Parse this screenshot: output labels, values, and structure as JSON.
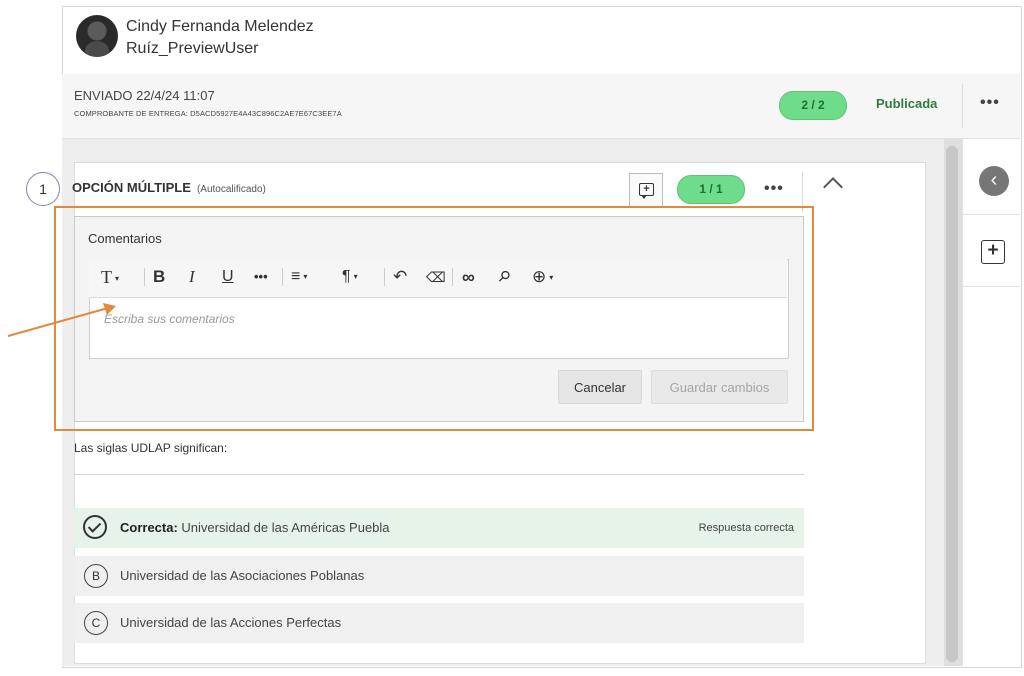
{
  "user": {
    "first_line": "Cindy Fernanda Melendez",
    "second_line": "Ruíz_PreviewUser"
  },
  "submission": {
    "sent_label": "ENVIADO 22/4/24 11:07",
    "receipt": "COMPROBANTE DE ENTREGA: D5ACD5927E4A43C896C2AE7E67C3EE7A",
    "score": "2 / 2",
    "status": "Publicada",
    "more": "•••"
  },
  "question": {
    "number": "1",
    "type": "OPCIÓN MÚLTIPLE",
    "grading": "(Autocalificado)",
    "score": "1 / 1",
    "more": "•••",
    "prompt": "Las siglas UDLAP significan:",
    "options": [
      {
        "mark": "",
        "prefix": "Correcta:",
        "text": " Universidad de las Américas Puebla",
        "note": "Respuesta correcta",
        "correct": true
      },
      {
        "mark": "B",
        "text": "Universidad de las Asociaciones Poblanas"
      },
      {
        "mark": "C",
        "text": "Universidad de las Acciones Perfectas"
      }
    ]
  },
  "comments": {
    "label": "Comentarios",
    "placeholder": "Escriba sus comentarios",
    "cancel": "Cancelar",
    "save": "Guardar cambios",
    "toolbar": {
      "text_style": "T",
      "bold": "B",
      "italic": "I",
      "underline": "U",
      "more": "•••",
      "align": "≡",
      "paragraph": "¶",
      "undo": "↶",
      "eraser": "⌫",
      "link": "∞",
      "attach": "⚲",
      "insert": "⊕"
    }
  },
  "colors": {
    "accent_orange": "#e08a3c",
    "score_green": "#6fdc8c",
    "published_text": "#2e7d3c"
  }
}
